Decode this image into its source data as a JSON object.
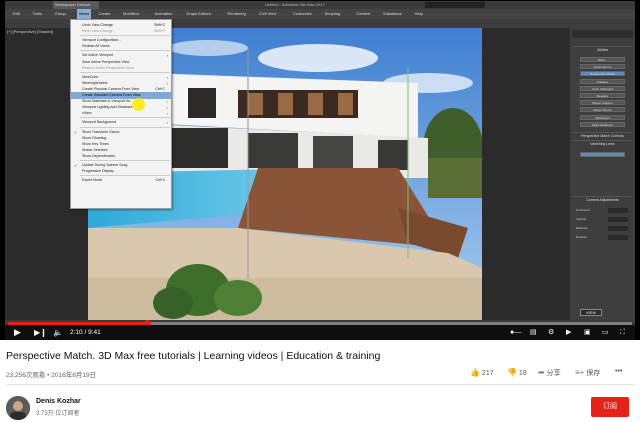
{
  "max": {
    "workspace": "Workspace: Default",
    "title": "Untitled - Autodesk 3ds Max 2017",
    "menus": [
      "Edit",
      "Tools",
      "Group",
      "Views",
      "Create",
      "Modifiers",
      "Animation",
      "Graph Editors",
      "Rendering",
      "Civil View",
      "Customize",
      "Scripting",
      "Content",
      "Substance",
      "Help"
    ],
    "active_menu": "Views",
    "viewport_label": "[+] [Perspective] [Shaded]",
    "views_menu": [
      {
        "label": "Undo View Change",
        "shortcut": "Shift+Z"
      },
      {
        "label": "Redo View Change",
        "shortcut": "Shift+Y",
        "dim": true
      },
      {
        "sep": true
      },
      {
        "label": "Viewport Configuration..."
      },
      {
        "label": "Redraw All Views"
      },
      {
        "sep": true
      },
      {
        "label": "Set Active Viewport",
        "arrow": true
      },
      {
        "label": "Save Active Perspective View"
      },
      {
        "label": "Restore Active Perspective View",
        "dim": true
      },
      {
        "sep": true
      },
      {
        "label": "ViewCube",
        "arrow": true
      },
      {
        "label": "SteeringWheels",
        "arrow": true
      },
      {
        "label": "Create Physical Camera From View",
        "shortcut": "Ctrl+C"
      },
      {
        "label": "Create Standard Camera From View",
        "highlight": true
      },
      {
        "label": "Show Materials in Viewport As",
        "arrow": true
      },
      {
        "label": "Viewport Lighting and Shadows",
        "arrow": true
      },
      {
        "label": "xView",
        "arrow": true
      },
      {
        "sep": true
      },
      {
        "label": "Viewport Background",
        "arrow": true
      },
      {
        "sep": true
      },
      {
        "label": "Show Transform Gizmo",
        "check": true
      },
      {
        "label": "Show Ghosting"
      },
      {
        "label": "Show Key Times"
      },
      {
        "label": "Shade Selected"
      },
      {
        "label": "Show Dependencies"
      },
      {
        "sep": true
      },
      {
        "label": "Update During Spinner Drag",
        "check": true
      },
      {
        "label": "Progressive Display"
      },
      {
        "sep": true
      },
      {
        "label": "Expert Mode",
        "shortcut": "Ctrl+X"
      }
    ],
    "panel": {
      "header1": "Utilities",
      "buttons": [
        "More...",
        "Reset XForm",
        "Perspective Match",
        "Collapse",
        "Color Clipboard",
        "Measure",
        "Motion Capture",
        "Reset XForm",
        "MAXScript",
        "Flight Studio (c)"
      ],
      "selected_button": "Perspective Match",
      "header2": "Perspective Match Controls",
      "header3": "Vanishing Lines",
      "header4": "Camera Adjustments",
      "rows": [
        "Horizontal",
        "Vertical",
        "Distance",
        "Rotation"
      ],
      "view_button": "VIEW"
    },
    "colors": {
      "menu_highlight": "#7fa7d8",
      "panel_selected": "#5c8cc4",
      "cursor": "#ffe600"
    }
  },
  "player": {
    "time": "2:10 / 9:41",
    "progress": 0.224,
    "accent": "#e62117"
  },
  "video": {
    "title": "Perspective Match. 3D Max free tutorials | Learning videos | Education & training",
    "views_date": "23,256次观看 • 2016年8月19日",
    "likes": "217",
    "dislikes": "18",
    "share": "分享",
    "save": "保存",
    "more": "•••"
  },
  "channel": {
    "name": "Denis Kozhar",
    "subscribers": "3.73万 位订阅者",
    "subscribe_label": "订阅"
  }
}
